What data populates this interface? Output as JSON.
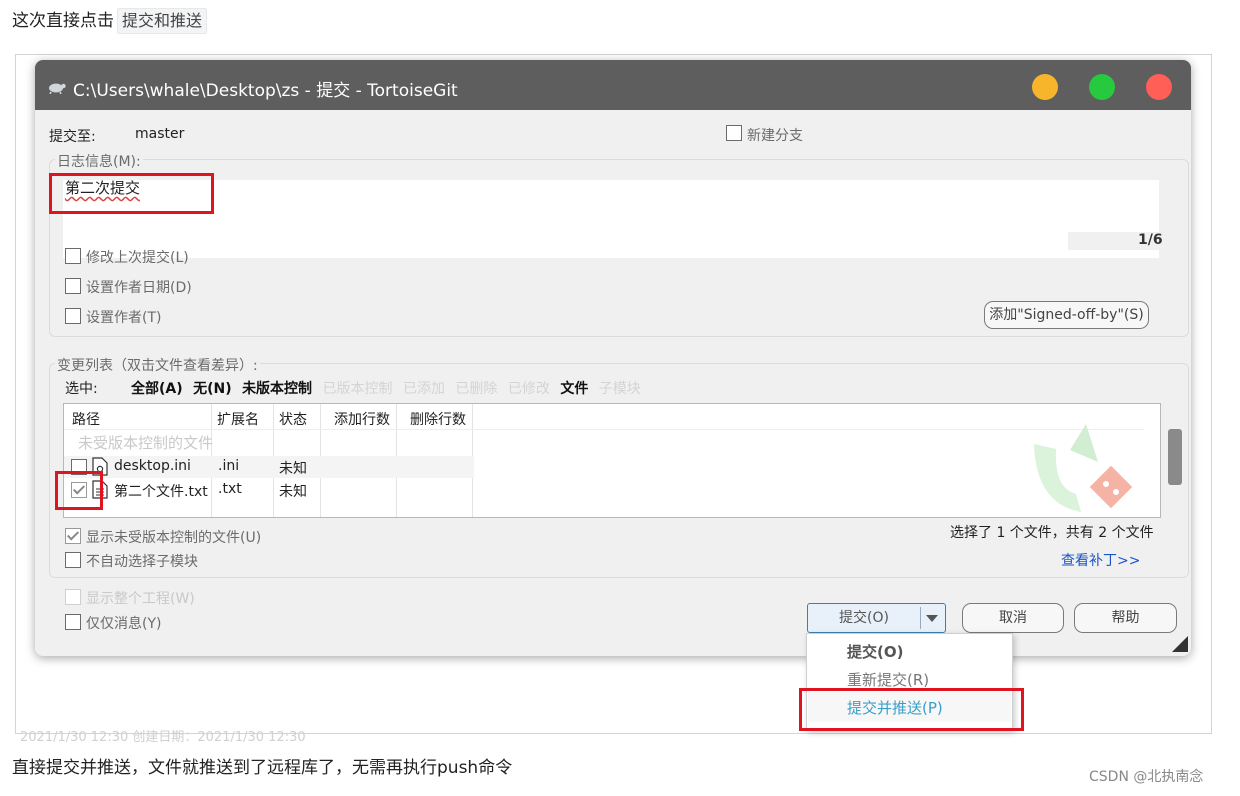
{
  "blog": {
    "intro": "这次直接点击",
    "intro_code": "提交和推送",
    "outro": "直接提交并推送，文件就推送到了远程库了，无需再执行push命令",
    "watermark": "CSDN @北执南念",
    "ghost_date": "2021/1/30 12:30        创建日期：2021/1/30 12:30"
  },
  "window": {
    "title": "C:\\Users\\whale\\Desktop\\zs - 提交 - TortoiseGit",
    "title_buttons": [
      "#f7b52c",
      "#27c93f",
      "#ff5f57"
    ]
  },
  "commit": {
    "commit_to_label": "提交至:",
    "branch": "master",
    "new_branch": "新建分支",
    "log_group": "日志信息(M):",
    "message": "第二次提交",
    "counter": "1/6",
    "amend": "修改上次提交(L)",
    "set_date": "设置作者日期(D)",
    "set_author": "设置作者(T)",
    "signed_off": "添加\"Signed-off-by\"(S)"
  },
  "changes": {
    "group": "变更列表（双击文件查看差异）:",
    "select_label": "选中:",
    "filters": [
      {
        "label": "全部(A)",
        "active": true
      },
      {
        "label": "无(N)",
        "active": true
      },
      {
        "label": "未版本控制",
        "active": true
      },
      {
        "label": "已版本控制",
        "active": false
      },
      {
        "label": "已添加",
        "active": false
      },
      {
        "label": "已删除",
        "active": false
      },
      {
        "label": "已修改",
        "active": false
      },
      {
        "label": "文件",
        "active": true
      },
      {
        "label": "子模块",
        "active": false
      }
    ],
    "columns": [
      "路径",
      "扩展名",
      "状态",
      "添加行数",
      "删除行数"
    ],
    "group_row": "未受版本控制的文件",
    "rows": [
      {
        "name": "desktop.ini",
        "ext": ".ini",
        "status": "未知",
        "checked": false
      },
      {
        "name": "第二个文件.txt",
        "ext": ".txt",
        "status": "未知",
        "checked": true
      }
    ],
    "show_unversioned": "显示未受版本控制的文件(U)",
    "no_autoselect": "不自动选择子模块",
    "summary": "选择了 1 个文件，共有 2 个文件",
    "view_patch": "查看补丁>>"
  },
  "footer": {
    "whole_project": "显示整个工程(W)",
    "message_only": "仅仅消息(Y)",
    "commit_btn": "提交(O)",
    "cancel_btn": "取消",
    "help_btn": "帮助"
  },
  "menu": {
    "items": [
      {
        "label": "提交(O)",
        "style": "bold"
      },
      {
        "label": "重新提交(R)",
        "style": "normal"
      },
      {
        "label": "提交并推送(P)",
        "style": "highlight"
      }
    ]
  }
}
